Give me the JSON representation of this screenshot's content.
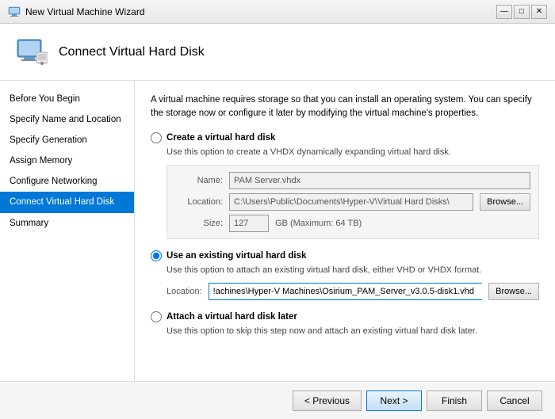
{
  "titleBar": {
    "title": "New Virtual Machine Wizard",
    "controls": {
      "minimize": "—",
      "maximize": "□",
      "close": "✕"
    }
  },
  "header": {
    "title": "Connect Virtual Hard Disk",
    "iconAlt": "wizard-icon"
  },
  "sidebar": {
    "items": [
      {
        "id": "before-you-begin",
        "label": "Before You Begin",
        "active": false
      },
      {
        "id": "specify-name",
        "label": "Specify Name and Location",
        "active": false
      },
      {
        "id": "specify-generation",
        "label": "Specify Generation",
        "active": false
      },
      {
        "id": "assign-memory",
        "label": "Assign Memory",
        "active": false
      },
      {
        "id": "configure-networking",
        "label": "Configure Networking",
        "active": false
      },
      {
        "id": "connect-vhd",
        "label": "Connect Virtual Hard Disk",
        "active": true
      },
      {
        "id": "summary",
        "label": "Summary",
        "active": false
      }
    ]
  },
  "content": {
    "intro": "A virtual machine requires storage so that you can install an operating system. You can specify the storage now or configure it later by modifying the virtual machine's properties.",
    "options": [
      {
        "id": "create-new",
        "label": "Create a virtual hard disk",
        "description": "Use this option to create a VHDX dynamically expanding virtual hard disk.",
        "selected": false,
        "fields": {
          "name": {
            "label": "Name:",
            "value": "PAM Server.vhdx"
          },
          "location": {
            "label": "Location:",
            "value": "C:\\Users\\Public\\Documents\\Hyper-V\\Virtual Hard Disks\\",
            "browseLabel": "Browse..."
          },
          "size": {
            "label": "Size:",
            "value": "127",
            "unit": "GB (Maximum: 64 TB)"
          }
        }
      },
      {
        "id": "use-existing",
        "label": "Use an existing virtual hard disk",
        "description": "Use this option to attach an existing virtual hard disk, either VHD or VHDX format.",
        "selected": true,
        "fields": {
          "location": {
            "label": "Location:",
            "value": "!achines\\Hyper-V Machines\\Osirium_PAM_Server_v3.0.5-disk1.vhd",
            "browseLabel": "Browse..."
          }
        }
      },
      {
        "id": "attach-later",
        "label": "Attach a virtual hard disk later",
        "description": "Use this option to skip this step now and attach an existing virtual hard disk later.",
        "selected": false
      }
    ]
  },
  "footer": {
    "previousLabel": "< Previous",
    "nextLabel": "Next >",
    "finishLabel": "Finish",
    "cancelLabel": "Cancel"
  }
}
